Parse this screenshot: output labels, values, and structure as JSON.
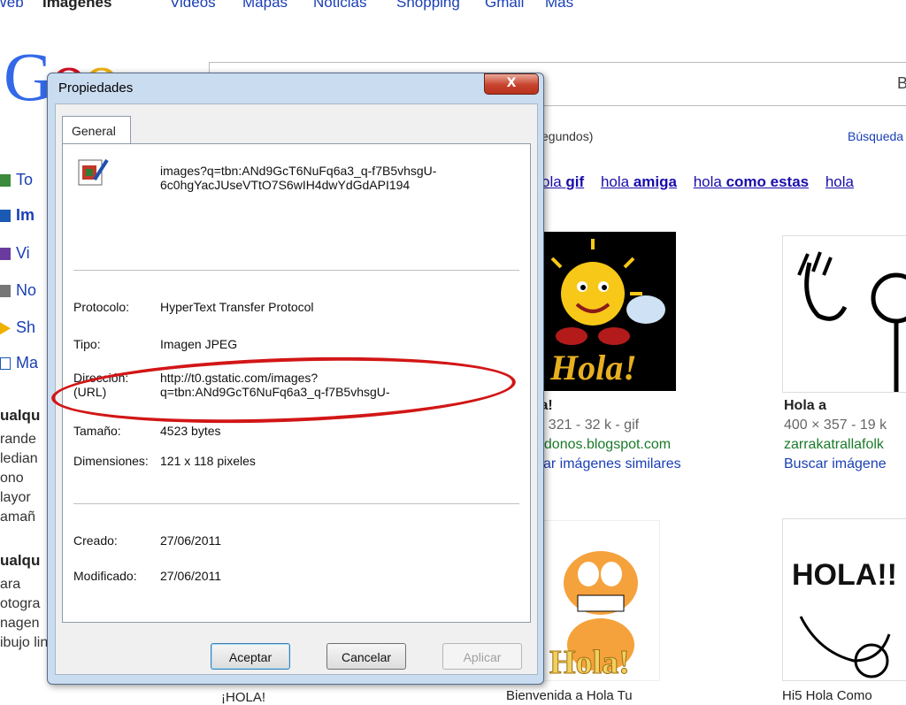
{
  "topnav": {
    "items": [
      "Web",
      "Imágenes",
      "Videos",
      "Mapas",
      "Noticias",
      "Shopping",
      "Gmail",
      "Más"
    ]
  },
  "logo": {
    "text": "Goo"
  },
  "search": {
    "button_label": "B"
  },
  "results_info": "egundos)",
  "advanced_search": "Búsqueda",
  "related": [
    {
      "prefix": "ola",
      "bold": "gif"
    },
    {
      "prefix": "hola",
      "bold": "amiga"
    },
    {
      "prefix": "hola",
      "bold": "como estas"
    },
    {
      "prefix": "hola",
      "bold": ""
    }
  ],
  "sidebar": {
    "nav": [
      {
        "label": "To",
        "icon": "green-square-icon",
        "color": "#3c8a3c"
      },
      {
        "label": "Im",
        "icon": "images-icon",
        "color": "#1a5ab5"
      },
      {
        "label": "Vi",
        "icon": "video-icon",
        "color": "#6a3ca0"
      },
      {
        "label": "No",
        "icon": "news-icon",
        "color": "#777777"
      },
      {
        "label": "Sh",
        "icon": "shopping-tag-icon",
        "color": "#f0b000"
      },
      {
        "label": "Ma",
        "icon": "more-icon",
        "color": "#1a5ab5"
      }
    ],
    "size_heading": "ualqu",
    "size_options": [
      "rande",
      "ledian",
      "ono",
      "layor",
      "amañ"
    ],
    "type_heading": "ualqu",
    "type_options": [
      "ara",
      "otogra",
      "nagen",
      "ibujo lineal"
    ]
  },
  "results": [
    {
      "title": "la!",
      "meta": "× 321 - 32 k - gif",
      "url": "ndonos.blogspot.com",
      "similar": "car imágenes similares",
      "thumb_text": "Hola!"
    },
    {
      "title": "Hola a",
      "meta": "400 × 357 - 19 k",
      "url": "zarrakatrallafolk",
      "similar": "Buscar imágene",
      "thumb_text": ""
    }
  ],
  "bottom_row": [
    {
      "thumb_text": "Hola!",
      "caption": "Bienvenida a Hola Tu"
    },
    {
      "thumb_text": "HOLA!!",
      "caption": "Hi5 Hola Como"
    }
  ],
  "left_bottom_caption": "¡HOLA!",
  "dialog": {
    "title": "Propiedades",
    "close_label": "X",
    "tab": "General",
    "filename_line1": "images?q=tbn:ANd9GcT6NuFq6a3_q-f7B5vhsgU-",
    "filename_line2": "6c0hgYacJUseVTtO7S6wIH4dwYdGdAPI194",
    "props": [
      {
        "label": "Protocolo:",
        "value": "HyperText Transfer Protocol"
      },
      {
        "label": "Tipo:",
        "value": "Imagen JPEG"
      },
      {
        "label": "Dirección:",
        "label2": "(URL)",
        "value": "http://t0.gstatic.com/images?",
        "value2": "q=tbn:ANd9GcT6NuFq6a3_q-f7B5vhsgU-"
      },
      {
        "label": "Tamaño:",
        "value": "4523 bytes"
      },
      {
        "label": "Dimensiones:",
        "value": "121 x 118 pixeles"
      }
    ],
    "created_label": "Creado:",
    "created_value": "27/06/2011",
    "modified_label": "Modificado:",
    "modified_value": "27/06/2011",
    "buttons": {
      "ok": "Aceptar",
      "cancel": "Cancelar",
      "apply": "Aplicar"
    }
  },
  "colors": {
    "link": "#1a0dab",
    "url_green": "#1b7a2b",
    "annotation_red": "#d21616",
    "dialog_frame": "#c9dcf0"
  }
}
